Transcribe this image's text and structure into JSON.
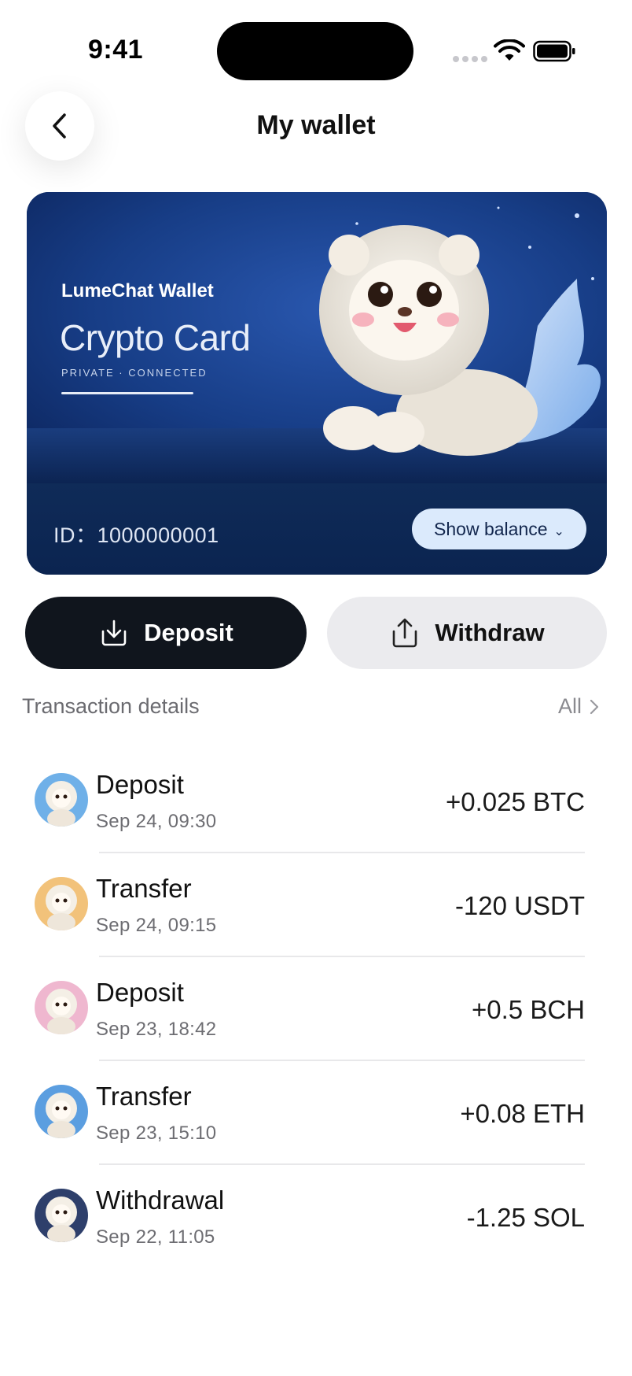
{
  "status_bar": {
    "time": "9:41"
  },
  "header": {
    "title": "My wallet"
  },
  "card": {
    "brand": "LumeChat Wallet",
    "title": "Crypto Card",
    "subtitle": "PRIVATE · CONNECTED",
    "id_text": "ID：1000000001",
    "show_balance_label": "Show balance",
    "colors": {
      "card_bg": "#0d2a5a",
      "balance_button_bg": "#dbeafc"
    }
  },
  "actions": {
    "deposit_label": "Deposit",
    "withdraw_label": "Withdraw"
  },
  "transactions": {
    "section_title": "Transaction details",
    "all_label": "All",
    "items": [
      {
        "type": "Deposit",
        "date": "Sep 24, 09:30",
        "amount": "+0.025 BTC",
        "avatar_tone": "#6fb0e8"
      },
      {
        "type": "Transfer",
        "date": "Sep 24, 09:15",
        "amount": "-120 USDT",
        "avatar_tone": "#f2c27a"
      },
      {
        "type": "Deposit",
        "date": "Sep 23, 18:42",
        "amount": "+0.5 BCH",
        "avatar_tone": "#efb7cf"
      },
      {
        "type": "Transfer",
        "date": "Sep 23, 15:10",
        "amount": "+0.08 ETH",
        "avatar_tone": "#5b9ee0"
      },
      {
        "type": "Withdrawal",
        "date": "Sep 22, 11:05",
        "amount": "-1.25 SOL",
        "avatar_tone": "#2e3f6b"
      }
    ]
  }
}
